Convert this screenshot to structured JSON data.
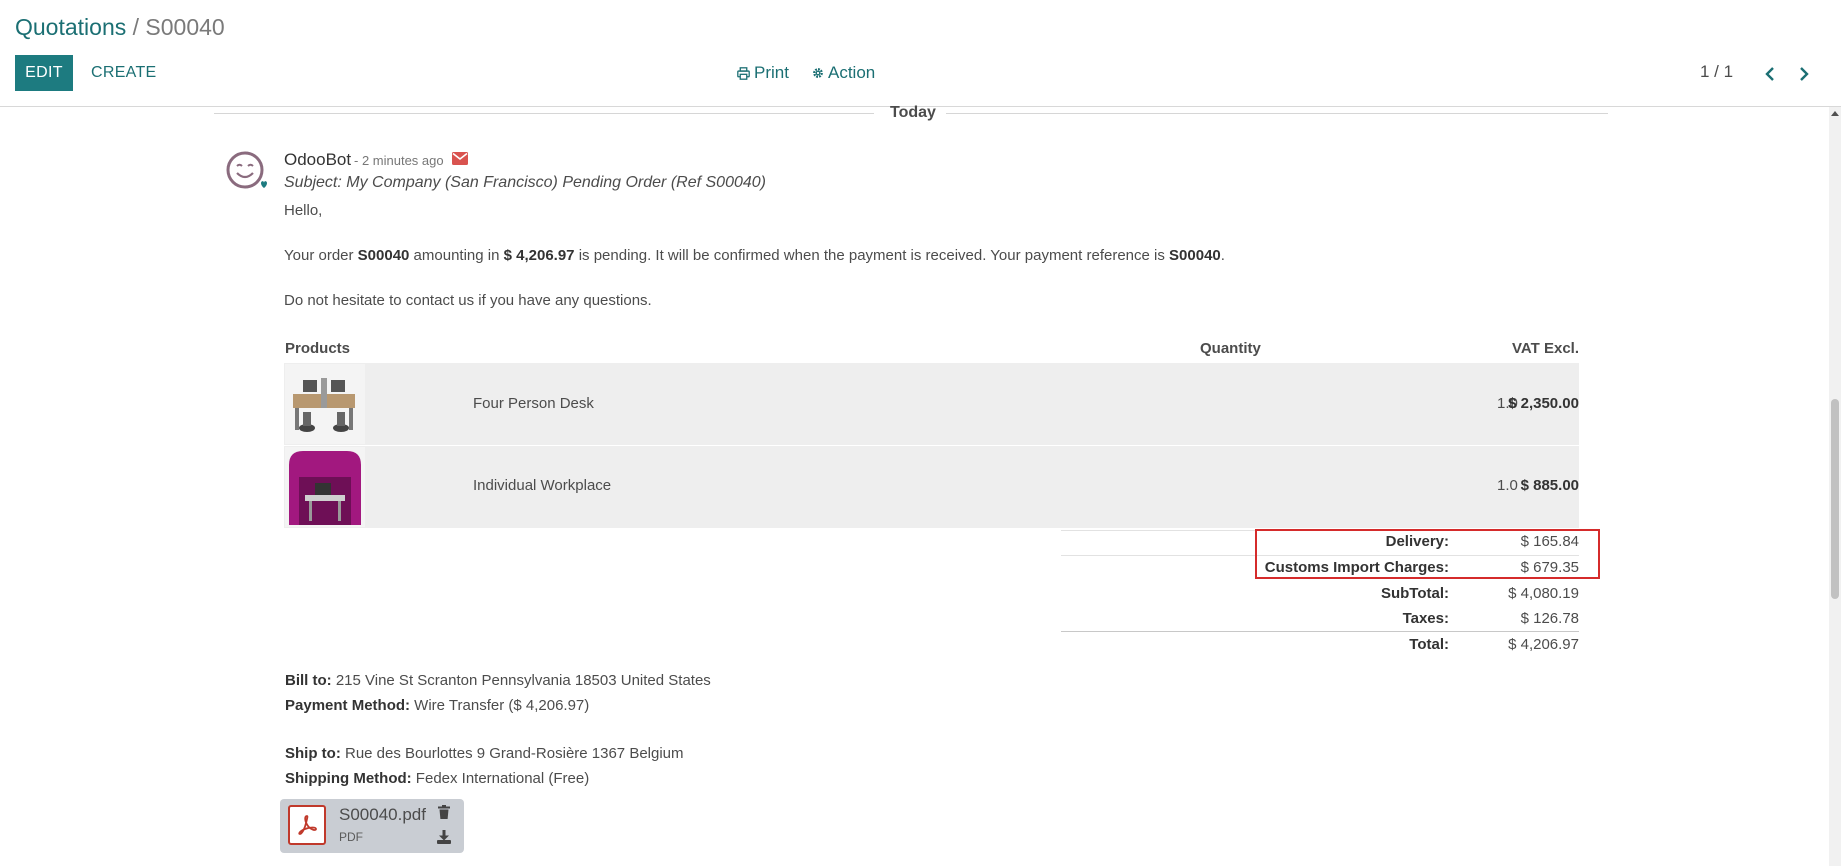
{
  "breadcrumb": {
    "parent": "Quotations",
    "separator": " / ",
    "current": "S00040"
  },
  "toolbar": {
    "edit_label": "EDIT",
    "create_label": "CREATE",
    "print_label": "Print",
    "action_label": "Action"
  },
  "pager": {
    "value": "1 / 1"
  },
  "chatter": {
    "date_separator": "Today",
    "message": {
      "author": "OdooBot",
      "time": "- 2 minutes ago",
      "subject": "Subject: My Company (San Francisco) Pending Order (Ref S00040)",
      "greeting": "Hello,",
      "body": {
        "t1": "Your order ",
        "order_ref": "S00040",
        "t2": " amounting in ",
        "amount": "$ 4,206.97",
        "t3": " is pending. It will be confirmed when the payment is received. Your payment reference is ",
        "payment_ref": "S00040",
        "t4": "."
      },
      "closing": "Do not hesitate to contact us if you have any questions."
    }
  },
  "products": {
    "headers": {
      "product": "Products",
      "quantity": "Quantity",
      "price": "VAT Excl."
    },
    "rows": [
      {
        "name": "Four Person Desk",
        "qty": "1.0",
        "price": "$ 2,350.00"
      },
      {
        "name": "Individual Workplace",
        "qty": "1.0",
        "price": "$ 885.00"
      }
    ]
  },
  "totals": {
    "delivery": {
      "label": "Delivery:",
      "value": "$ 165.84"
    },
    "customs": {
      "label": "Customs Import Charges:",
      "value": "$ 679.35"
    },
    "subtotal": {
      "label": "SubTotal:",
      "value": "$ 4,080.19"
    },
    "taxes": {
      "label": "Taxes:",
      "value": "$ 126.78"
    },
    "total": {
      "label": "Total:",
      "value": "$ 4,206.97"
    }
  },
  "billing": {
    "bill_to_label": "Bill to:",
    "bill_to": " 215 Vine St Scranton Pennsylvania 18503 United States",
    "payment_label": "Payment Method:",
    "payment": " Wire Transfer ($ 4,206.97)",
    "ship_to_label": "Ship to:",
    "ship_to": " Rue des Bourlottes 9 Grand-Rosière 1367 Belgium",
    "shipping_label": "Shipping Method:",
    "shipping": " Fedex International (Free)"
  },
  "attachment": {
    "name": "S00040.pdf",
    "type": "PDF"
  },
  "colors": {
    "primary": "#1d7b80",
    "link": "#1b6f73",
    "highlight": "#d52b2b",
    "mail_icon": "#d9534f"
  },
  "icons": [
    "print-icon",
    "gear-icon",
    "chevron-left-icon",
    "chevron-right-icon",
    "envelope-icon",
    "pdf-icon",
    "trash-icon",
    "download-icon",
    "odoobot-avatar-icon"
  ]
}
